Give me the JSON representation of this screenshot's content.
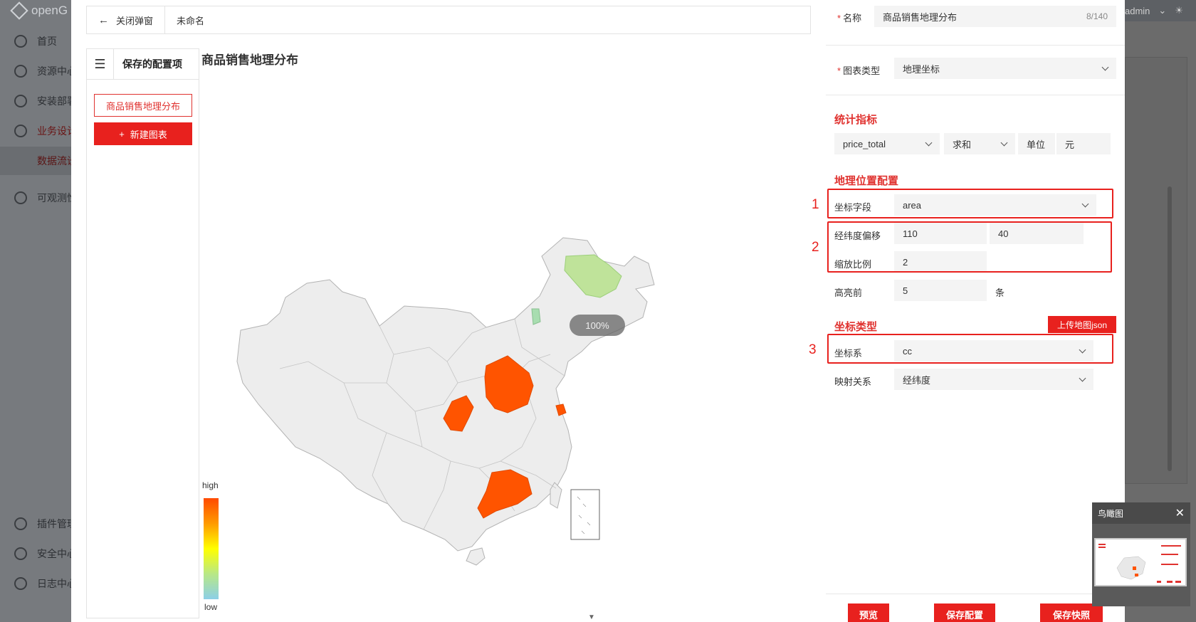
{
  "background_app": {
    "logo_text": "openG",
    "nav": [
      "首页",
      "资源中心",
      "安装部署",
      "业务设计",
      "数据流设",
      "可观测性",
      "插件管理",
      "安全中心",
      "日志中心"
    ],
    "user": "admin"
  },
  "topbar": {
    "close_label": "关闭弹窗",
    "doc_name": "未命名"
  },
  "saved_panel": {
    "title": "保存的配置项",
    "item": "商品销售地理分布",
    "new_button": "新建图表"
  },
  "chart": {
    "title": "商品销售地理分布",
    "legend_high": "high",
    "legend_low": "low",
    "zoom": "100%"
  },
  "chart_data": {
    "type": "map",
    "title": "商品销售地理分布",
    "region": "China",
    "visual_map": {
      "high": "high",
      "low": "low",
      "colors": [
        "#ff4a00",
        "#ffff00",
        "#8ccfe8"
      ]
    },
    "highlighted_regions": [
      {
        "color": "#ff5400",
        "level": "high"
      },
      {
        "color": "#ff5400",
        "level": "high"
      },
      {
        "color": "#ff5400",
        "level": "high"
      },
      {
        "color": "#ff5400",
        "level": "high"
      },
      {
        "color": "#bfe39a",
        "level": "low"
      },
      {
        "color": "#a8ddb0",
        "level": "low"
      }
    ]
  },
  "config": {
    "name_label": "名称",
    "name_value": "商品销售地理分布",
    "name_count": "8/140",
    "chart_type_label": "图表类型",
    "chart_type_value": "地理坐标",
    "metric_section": "统计指标",
    "metric_field": "price_total",
    "metric_agg": "求和",
    "unit_label": "单位",
    "unit_value": "元",
    "geo_section": "地理位置配置",
    "coord_field_label": "坐标字段",
    "coord_field_value": "area",
    "offset_label": "经纬度偏移",
    "offset_lng": "110",
    "offset_lat": "40",
    "scale_label": "缩放比例",
    "scale_value": "2",
    "top_label": "高亮前",
    "top_value": "5",
    "top_unit": "条",
    "coord_type_section": "坐标类型",
    "upload_button": "上传地图json",
    "coord_sys_label": "坐标系",
    "coord_sys_value": "cc",
    "mapping_label": "映射关系",
    "mapping_value": "经纬度",
    "annot_1": "1",
    "annot_2": "2",
    "annot_3": "3"
  },
  "footer": {
    "preview": "预览",
    "save_config": "保存配置",
    "save_snapshot": "保存快照"
  },
  "birdseye": {
    "title": "鸟瞰图"
  }
}
